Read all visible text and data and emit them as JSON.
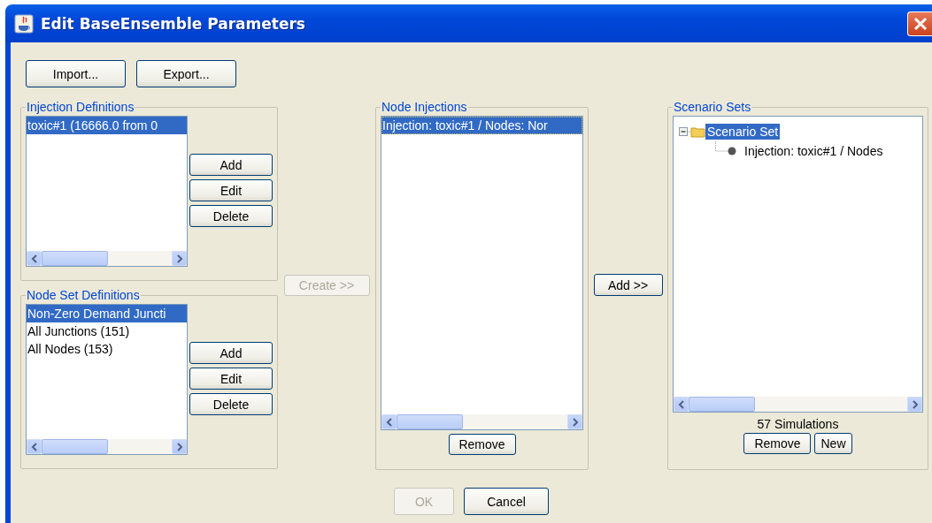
{
  "window": {
    "title": "Edit BaseEnsemble Parameters"
  },
  "toolbar": [
    {
      "label": "Import..."
    },
    {
      "label": "Export..."
    }
  ],
  "injection_definitions": {
    "title": "Injection Definitions",
    "items": [
      {
        "label": "toxic#1 (16666.0 from 0",
        "selected": true
      }
    ],
    "buttons": [
      "Add",
      "Edit",
      "Delete"
    ]
  },
  "node_set_definitions": {
    "title": "Node Set Definitions",
    "items": [
      {
        "label": "Non-Zero Demand Juncti",
        "selected": true
      },
      {
        "label": "All Junctions (151)",
        "selected": false
      },
      {
        "label": "All Nodes (153)",
        "selected": false
      }
    ],
    "buttons": [
      "Add",
      "Edit",
      "Delete"
    ]
  },
  "create_button": {
    "label": "Create >>",
    "disabled": true
  },
  "node_injections": {
    "title": "Node Injections",
    "items": [
      {
        "label": "Injection: toxic#1 / Nodes: Nor",
        "selected": true
      }
    ],
    "buttons": [
      "Remove"
    ]
  },
  "add_button": {
    "label": "Add >>",
    "disabled": false
  },
  "scenario_sets": {
    "title": "Scenario Sets",
    "tree": [
      {
        "label": "Scenario Set",
        "selected": true,
        "expanded": true,
        "children": [
          {
            "label": "Injection: toxic#1 / Nodes",
            "selected": false
          }
        ]
      }
    ],
    "summary": "57 Simulations",
    "buttons": [
      "Remove",
      "New"
    ]
  },
  "dialog_buttons": [
    {
      "label": "OK",
      "disabled": true
    },
    {
      "label": "Cancel",
      "disabled": false
    }
  ]
}
